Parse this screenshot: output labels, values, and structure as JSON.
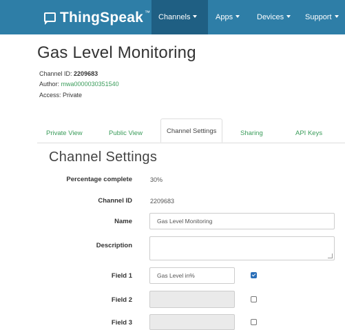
{
  "nav": {
    "brand": "ThingSpeak",
    "trademark": "™",
    "items": [
      "Channels",
      "Apps",
      "Devices",
      "Support"
    ]
  },
  "channel": {
    "title": "Gas Level Monitoring",
    "id_label": "Channel ID:",
    "id": "2209683",
    "author_label": "Author:",
    "author": "mwa0000030351540",
    "access_label": "Access:",
    "access": "Private"
  },
  "tabs": [
    "Private View",
    "Public View",
    "Channel Settings",
    "Sharing",
    "API Keys"
  ],
  "active_tab": "Channel Settings",
  "settings": {
    "title": "Channel Settings",
    "percent_label": "Percentage complete",
    "percent": "30%",
    "channel_id_label": "Channel ID",
    "channel_id": "2209683",
    "name_label": "Name",
    "name": "Gas Level Monitoring",
    "description_label": "Description",
    "description": "",
    "fields": [
      {
        "label": "Field 1",
        "value": "Gas Level in%",
        "checked": true
      },
      {
        "label": "Field 2",
        "value": "",
        "checked": false
      },
      {
        "label": "Field 3",
        "value": "",
        "checked": false
      }
    ]
  },
  "colors": {
    "navbar": "#2e7ea7",
    "active_nav": "#1f5f83",
    "link": "#3a9c5a",
    "checkbox_checked": "#2a6fb8"
  }
}
